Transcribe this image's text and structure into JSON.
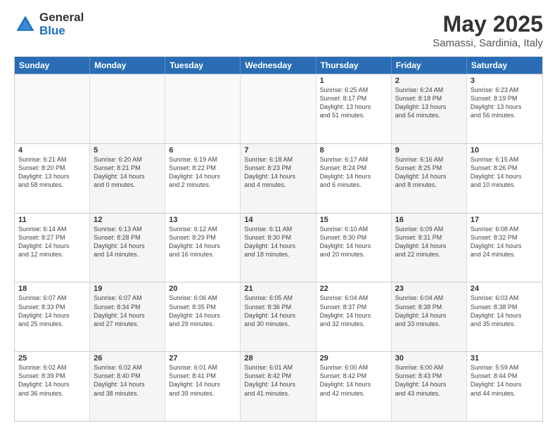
{
  "logo": {
    "general": "General",
    "blue": "Blue"
  },
  "title": "May 2025",
  "subtitle": "Samassi, Sardinia, Italy",
  "days": [
    "Sunday",
    "Monday",
    "Tuesday",
    "Wednesday",
    "Thursday",
    "Friday",
    "Saturday"
  ],
  "weeks": [
    [
      {
        "day": "",
        "info": "",
        "shaded": true
      },
      {
        "day": "",
        "info": "",
        "shaded": true
      },
      {
        "day": "",
        "info": "",
        "shaded": true
      },
      {
        "day": "",
        "info": "",
        "shaded": true
      },
      {
        "day": "1",
        "info": "Sunrise: 6:25 AM\nSunset: 8:17 PM\nDaylight: 13 hours\nand 51 minutes.",
        "shaded": false
      },
      {
        "day": "2",
        "info": "Sunrise: 6:24 AM\nSunset: 8:18 PM\nDaylight: 13 hours\nand 54 minutes.",
        "shaded": true
      },
      {
        "day": "3",
        "info": "Sunrise: 6:23 AM\nSunset: 8:19 PM\nDaylight: 13 hours\nand 56 minutes.",
        "shaded": false
      }
    ],
    [
      {
        "day": "4",
        "info": "Sunrise: 6:21 AM\nSunset: 8:20 PM\nDaylight: 13 hours\nand 58 minutes.",
        "shaded": false
      },
      {
        "day": "5",
        "info": "Sunrise: 6:20 AM\nSunset: 8:21 PM\nDaylight: 14 hours\nand 0 minutes.",
        "shaded": true
      },
      {
        "day": "6",
        "info": "Sunrise: 6:19 AM\nSunset: 8:22 PM\nDaylight: 14 hours\nand 2 minutes.",
        "shaded": false
      },
      {
        "day": "7",
        "info": "Sunrise: 6:18 AM\nSunset: 8:23 PM\nDaylight: 14 hours\nand 4 minutes.",
        "shaded": true
      },
      {
        "day": "8",
        "info": "Sunrise: 6:17 AM\nSunset: 8:24 PM\nDaylight: 14 hours\nand 6 minutes.",
        "shaded": false
      },
      {
        "day": "9",
        "info": "Sunrise: 6:16 AM\nSunset: 8:25 PM\nDaylight: 14 hours\nand 8 minutes.",
        "shaded": true
      },
      {
        "day": "10",
        "info": "Sunrise: 6:15 AM\nSunset: 8:26 PM\nDaylight: 14 hours\nand 10 minutes.",
        "shaded": false
      }
    ],
    [
      {
        "day": "11",
        "info": "Sunrise: 6:14 AM\nSunset: 8:27 PM\nDaylight: 14 hours\nand 12 minutes.",
        "shaded": false
      },
      {
        "day": "12",
        "info": "Sunrise: 6:13 AM\nSunset: 8:28 PM\nDaylight: 14 hours\nand 14 minutes.",
        "shaded": true
      },
      {
        "day": "13",
        "info": "Sunrise: 6:12 AM\nSunset: 8:29 PM\nDaylight: 14 hours\nand 16 minutes.",
        "shaded": false
      },
      {
        "day": "14",
        "info": "Sunrise: 6:11 AM\nSunset: 8:30 PM\nDaylight: 14 hours\nand 18 minutes.",
        "shaded": true
      },
      {
        "day": "15",
        "info": "Sunrise: 6:10 AM\nSunset: 8:30 PM\nDaylight: 14 hours\nand 20 minutes.",
        "shaded": false
      },
      {
        "day": "16",
        "info": "Sunrise: 6:09 AM\nSunset: 8:31 PM\nDaylight: 14 hours\nand 22 minutes.",
        "shaded": true
      },
      {
        "day": "17",
        "info": "Sunrise: 6:08 AM\nSunset: 8:32 PM\nDaylight: 14 hours\nand 24 minutes.",
        "shaded": false
      }
    ],
    [
      {
        "day": "18",
        "info": "Sunrise: 6:07 AM\nSunset: 8:33 PM\nDaylight: 14 hours\nand 25 minutes.",
        "shaded": false
      },
      {
        "day": "19",
        "info": "Sunrise: 6:07 AM\nSunset: 8:34 PM\nDaylight: 14 hours\nand 27 minutes.",
        "shaded": true
      },
      {
        "day": "20",
        "info": "Sunrise: 6:06 AM\nSunset: 8:35 PM\nDaylight: 14 hours\nand 29 minutes.",
        "shaded": false
      },
      {
        "day": "21",
        "info": "Sunrise: 6:05 AM\nSunset: 8:36 PM\nDaylight: 14 hours\nand 30 minutes.",
        "shaded": true
      },
      {
        "day": "22",
        "info": "Sunrise: 6:04 AM\nSunset: 8:37 PM\nDaylight: 14 hours\nand 32 minutes.",
        "shaded": false
      },
      {
        "day": "23",
        "info": "Sunrise: 6:04 AM\nSunset: 8:38 PM\nDaylight: 14 hours\nand 33 minutes.",
        "shaded": true
      },
      {
        "day": "24",
        "info": "Sunrise: 6:03 AM\nSunset: 8:38 PM\nDaylight: 14 hours\nand 35 minutes.",
        "shaded": false
      }
    ],
    [
      {
        "day": "25",
        "info": "Sunrise: 6:02 AM\nSunset: 8:39 PM\nDaylight: 14 hours\nand 36 minutes.",
        "shaded": false
      },
      {
        "day": "26",
        "info": "Sunrise: 6:02 AM\nSunset: 8:40 PM\nDaylight: 14 hours\nand 38 minutes.",
        "shaded": true
      },
      {
        "day": "27",
        "info": "Sunrise: 6:01 AM\nSunset: 8:41 PM\nDaylight: 14 hours\nand 39 minutes.",
        "shaded": false
      },
      {
        "day": "28",
        "info": "Sunrise: 6:01 AM\nSunset: 8:42 PM\nDaylight: 14 hours\nand 41 minutes.",
        "shaded": true
      },
      {
        "day": "29",
        "info": "Sunrise: 6:00 AM\nSunset: 8:42 PM\nDaylight: 14 hours\nand 42 minutes.",
        "shaded": false
      },
      {
        "day": "30",
        "info": "Sunrise: 6:00 AM\nSunset: 8:43 PM\nDaylight: 14 hours\nand 43 minutes.",
        "shaded": true
      },
      {
        "day": "31",
        "info": "Sunrise: 5:59 AM\nSunset: 8:44 PM\nDaylight: 14 hours\nand 44 minutes.",
        "shaded": false
      }
    ]
  ]
}
